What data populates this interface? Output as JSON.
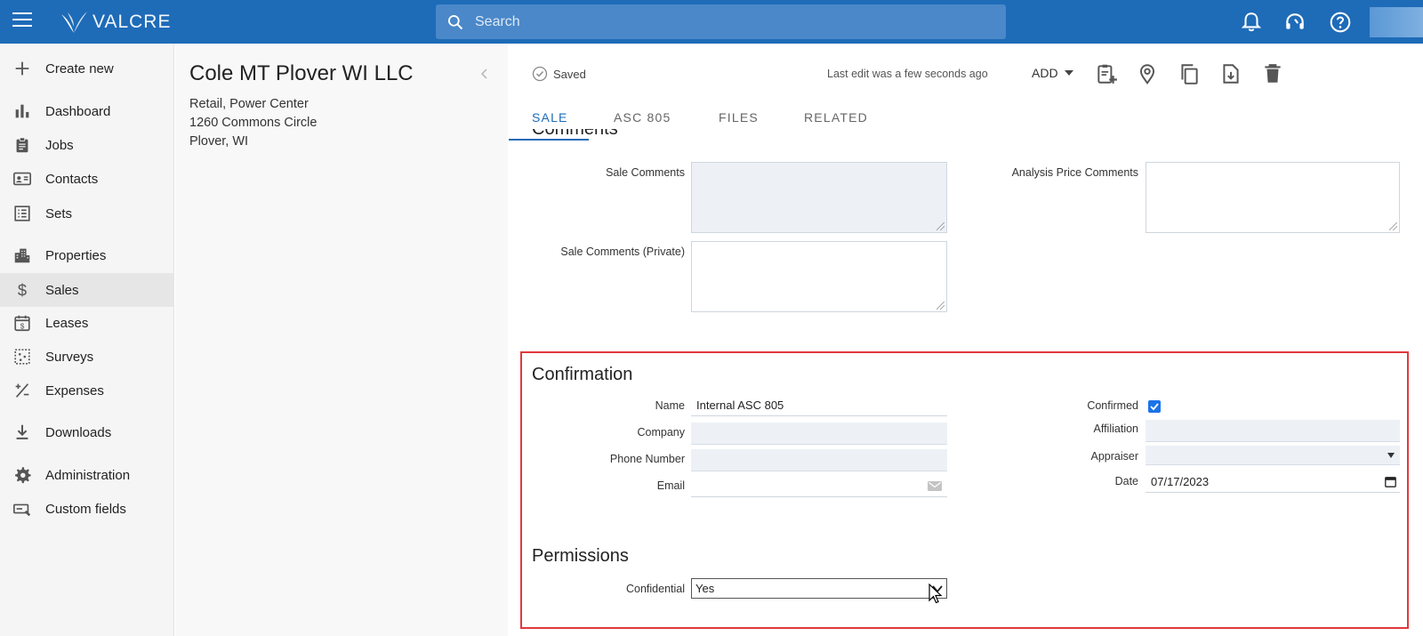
{
  "app": {
    "brand": "VALCRE",
    "search_placeholder": "Search"
  },
  "sidebar": {
    "items": [
      {
        "label": "Create new",
        "icon": "plus-icon"
      },
      {
        "label": "Dashboard",
        "icon": "bar-chart-icon"
      },
      {
        "label": "Jobs",
        "icon": "clipboard-icon"
      },
      {
        "label": "Contacts",
        "icon": "contact-card-icon"
      },
      {
        "label": "Sets",
        "icon": "list-icon"
      },
      {
        "label": "Properties",
        "icon": "building-icon"
      },
      {
        "label": "Sales",
        "icon": "dollar-icon"
      },
      {
        "label": "Leases",
        "icon": "calendar-dollar-icon"
      },
      {
        "label": "Surveys",
        "icon": "survey-icon"
      },
      {
        "label": "Expenses",
        "icon": "plus-minus-icon"
      },
      {
        "label": "Downloads",
        "icon": "download-icon"
      },
      {
        "label": "Administration",
        "icon": "gear-icon"
      },
      {
        "label": "Custom fields",
        "icon": "custom-field-icon"
      }
    ],
    "active": "Sales"
  },
  "property": {
    "title": "Cole MT Plover WI LLC",
    "type": "Retail, Power Center",
    "address": "1260 Commons Circle",
    "city": "Plover, WI"
  },
  "header": {
    "status": "Saved",
    "last_edit": "Last edit was a few seconds ago",
    "add_label": "ADD"
  },
  "tabs": [
    "SALE",
    "ASC 805",
    "FILES",
    "RELATED"
  ],
  "active_tab": "SALE",
  "comments": {
    "heading": "Comments",
    "sale_comments_label": "Sale Comments",
    "analysis_price_label": "Analysis Price Comments",
    "sale_private_label": "Sale Comments (Private)"
  },
  "confirmation": {
    "heading": "Confirmation",
    "name_label": "Name",
    "name_value": "Internal ASC 805",
    "company_label": "Company",
    "phone_label": "Phone Number",
    "email_label": "Email",
    "confirmed_label": "Confirmed",
    "confirmed": true,
    "affiliation_label": "Affiliation",
    "appraiser_label": "Appraiser",
    "date_label": "Date",
    "date_value": "07/17/2023"
  },
  "permissions": {
    "heading": "Permissions",
    "confidential_label": "Confidential",
    "confidential_value": "Yes"
  },
  "colors": {
    "topbar": "#1e6bb8",
    "accent": "#1e6bb8",
    "highlight": "#e0393e"
  }
}
